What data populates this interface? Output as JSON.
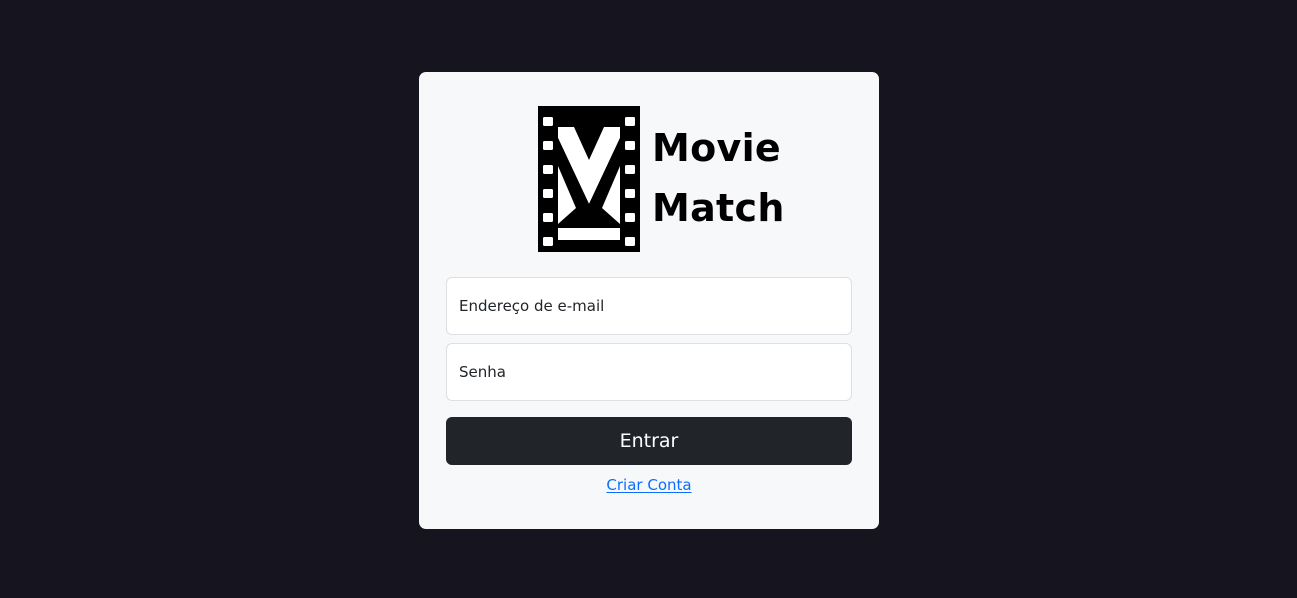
{
  "app": {
    "name_line1": "Movie",
    "name_line2": "Match"
  },
  "login_form": {
    "email_placeholder": "Endereço de e-mail",
    "password_placeholder": "Senha",
    "submit_label": "Entrar",
    "create_account_label": "Criar Conta"
  },
  "colors": {
    "page_background": "#16141e",
    "card_background": "#f7f8fa",
    "button_background": "#212529",
    "link": "#0d6efd"
  },
  "icons": {
    "logo": "film-strip-m-icon"
  }
}
